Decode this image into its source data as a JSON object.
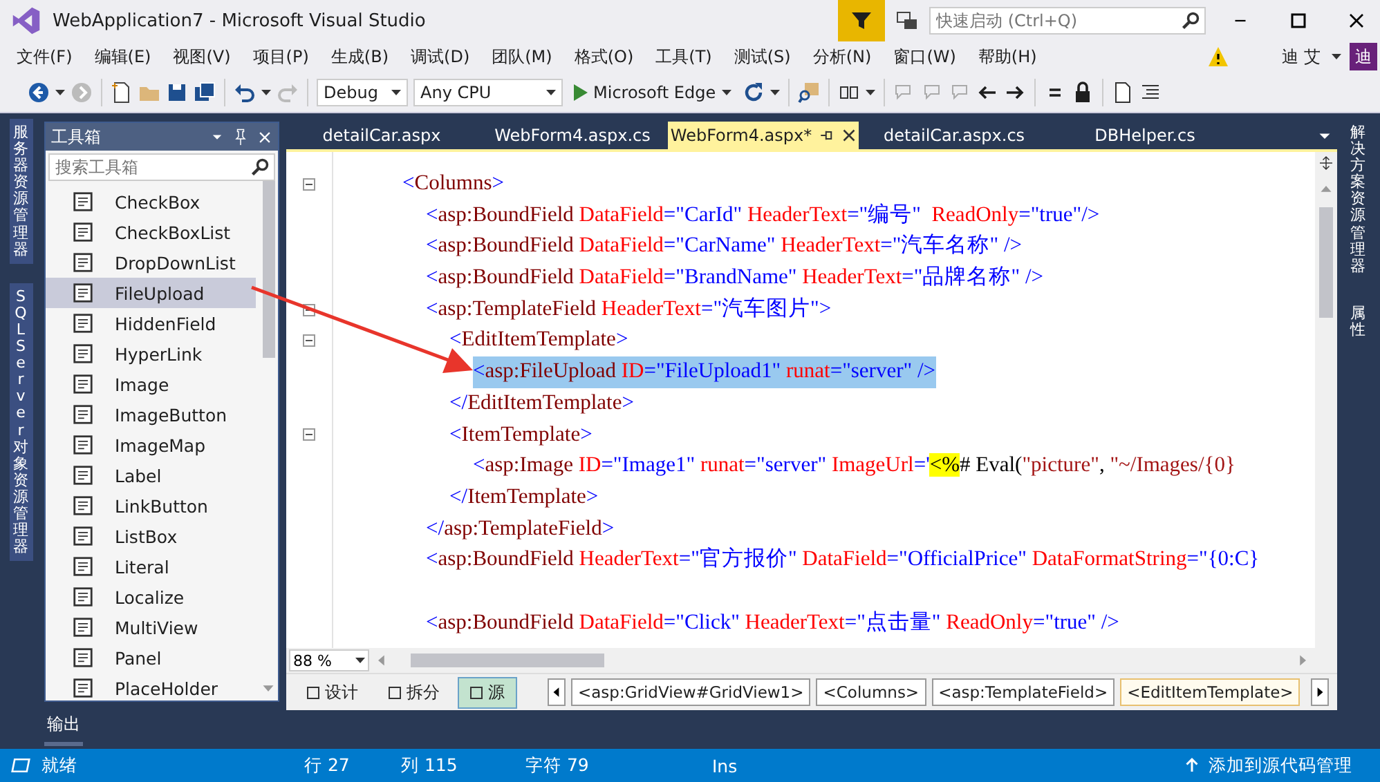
{
  "window": {
    "title": "WebApplication7 - Microsoft Visual Studio"
  },
  "quick_launch": {
    "placeholder": "快速启动 (Ctrl+Q)"
  },
  "menu": [
    "文件(F)",
    "编辑(E)",
    "视图(V)",
    "项目(P)",
    "生成(B)",
    "调试(D)",
    "团队(M)",
    "格式(O)",
    "工具(T)",
    "测试(S)",
    "分析(N)",
    "窗口(W)",
    "帮助(H)"
  ],
  "user": {
    "name": "迪 艾",
    "avatar": "迪"
  },
  "toolbar": {
    "configuration": "Debug",
    "platform": "Any CPU",
    "run_target": "Microsoft Edge"
  },
  "left_side_tabs": [
    "服务器资源管理器",
    "SQL Server 对象资源管理器"
  ],
  "right_side_tabs": [
    "解决方案资源管理器",
    "属性"
  ],
  "toolbox": {
    "title": "工具箱",
    "search": {
      "placeholder": "搜索工具箱"
    },
    "items": [
      {
        "label": "CheckBox",
        "selected": false
      },
      {
        "label": "CheckBoxList",
        "selected": false
      },
      {
        "label": "DropDownList",
        "selected": false
      },
      {
        "label": "FileUpload",
        "selected": true
      },
      {
        "label": "HiddenField",
        "selected": false
      },
      {
        "label": "HyperLink",
        "selected": false
      },
      {
        "label": "Image",
        "selected": false
      },
      {
        "label": "ImageButton",
        "selected": false
      },
      {
        "label": "ImageMap",
        "selected": false
      },
      {
        "label": "Label",
        "selected": false
      },
      {
        "label": "LinkButton",
        "selected": false
      },
      {
        "label": "ListBox",
        "selected": false
      },
      {
        "label": "Literal",
        "selected": false
      },
      {
        "label": "Localize",
        "selected": false
      },
      {
        "label": "MultiView",
        "selected": false
      },
      {
        "label": "Panel",
        "selected": false
      },
      {
        "label": "PlaceHolder",
        "selected": false
      }
    ]
  },
  "editor_tabs": [
    {
      "label": "detailCar.aspx",
      "selected": false
    },
    {
      "label": "WebForm4.aspx.cs",
      "selected": false
    },
    {
      "label": "WebForm4.aspx*",
      "selected": true
    },
    {
      "label": "detailCar.aspx.cs",
      "selected": false
    },
    {
      "label": "DBHelper.cs",
      "selected": false
    }
  ],
  "code_lines": [
    {
      "kind": "code",
      "foldable": true,
      "selected": false,
      "tokens": [
        {
          "kind": "punct",
          "text": "<"
        },
        {
          "kind": "tag",
          "text": "Columns"
        },
        {
          "kind": "punct",
          "text": ">"
        }
      ],
      "children": [
        {
          "kind": "code",
          "selected": false,
          "tokens": [
            {
              "kind": "punct",
              "text": "<"
            },
            {
              "kind": "tag",
              "text": "asp:BoundField"
            },
            {
              "kind": "attr",
              "text": " DataField"
            },
            {
              "kind": "value",
              "text": "=\"CarId\""
            },
            {
              "kind": "attr",
              "text": " HeaderText"
            },
            {
              "kind": "value",
              "text": "=\"编号\""
            },
            {
              "kind": "attr",
              "text": "  ReadOnly"
            },
            {
              "kind": "value",
              "text": "=\"true\"/>"
            }
          ]
        },
        {
          "kind": "code",
          "selected": false,
          "tokens": [
            {
              "kind": "punct",
              "text": "<"
            },
            {
              "kind": "tag",
              "text": "asp:BoundField"
            },
            {
              "kind": "attr",
              "text": " DataField"
            },
            {
              "kind": "value",
              "text": "=\"CarName\""
            },
            {
              "kind": "attr",
              "text": " HeaderText"
            },
            {
              "kind": "value",
              "text": "=\"汽车名称\" />"
            }
          ]
        },
        {
          "kind": "code",
          "selected": false,
          "tokens": [
            {
              "kind": "punct",
              "text": "<"
            },
            {
              "kind": "tag",
              "text": "asp:BoundField"
            },
            {
              "kind": "attr",
              "text": " DataField"
            },
            {
              "kind": "value",
              "text": "=\"BrandName\""
            },
            {
              "kind": "attr",
              "text": " HeaderText"
            },
            {
              "kind": "value",
              "text": "=\"品牌名称\" />"
            }
          ]
        },
        {
          "kind": "code",
          "foldable": true,
          "selected": false,
          "tokens": [
            {
              "kind": "punct",
              "text": "<"
            },
            {
              "kind": "tag",
              "text": "asp:TemplateField"
            },
            {
              "kind": "attr",
              "text": " HeaderText"
            },
            {
              "kind": "value",
              "text": "=\"汽车图片\">"
            }
          ],
          "children": [
            {
              "kind": "code",
              "foldable": true,
              "selected": false,
              "tokens": [
                {
                  "kind": "punct",
                  "text": "<"
                },
                {
                  "kind": "tag",
                  "text": "EditItemTemplate"
                },
                {
                  "kind": "punct",
                  "text": ">"
                }
              ],
              "children": [
                {
                  "kind": "code",
                  "selected": true,
                  "tokens": [
                    {
                      "kind": "punct",
                      "text": "<"
                    },
                    {
                      "kind": "tag",
                      "text": "asp:FileUpload"
                    },
                    {
                      "kind": "attr",
                      "text": " ID"
                    },
                    {
                      "kind": "value",
                      "text": "=\"FileUpload1\""
                    },
                    {
                      "kind": "attr",
                      "text": " runat"
                    },
                    {
                      "kind": "value",
                      "text": "=\"server\" />"
                    }
                  ]
                }
              ]
            },
            {
              "kind": "code",
              "selected": false,
              "tokens": [
                {
                  "kind": "punct",
                  "text": "</"
                },
                {
                  "kind": "tag",
                  "text": "EditItemTemplate"
                },
                {
                  "kind": "punct",
                  "text": ">"
                }
              ]
            },
            {
              "kind": "code",
              "foldable": true,
              "selected": false,
              "tokens": [
                {
                  "kind": "punct",
                  "text": "<"
                },
                {
                  "kind": "tag",
                  "text": "ItemTemplate"
                },
                {
                  "kind": "punct",
                  "text": ">"
                }
              ],
              "children": [
                {
                  "kind": "code",
                  "selected": false,
                  "tokens": [
                    {
                      "kind": "punct",
                      "text": "<"
                    },
                    {
                      "kind": "tag",
                      "text": "asp:Image"
                    },
                    {
                      "kind": "attr",
                      "text": " ID"
                    },
                    {
                      "kind": "value",
                      "text": "=\"Image1\""
                    },
                    {
                      "kind": "attr",
                      "text": " runat"
                    },
                    {
                      "kind": "value",
                      "text": "=\"server\""
                    },
                    {
                      "kind": "attr",
                      "text": " ImageUrl"
                    },
                    {
                      "kind": "value",
                      "text": "='"
                    },
                    {
                      "kind": "server",
                      "text": "<%"
                    },
                    {
                      "kind": "plain",
                      "text": "# Eval("
                    },
                    {
                      "kind": "string",
                      "text": "\"picture\""
                    },
                    {
                      "kind": "plain",
                      "text": ", "
                    },
                    {
                      "kind": "string",
                      "text": "\"~/Images/{0}"
                    }
                  ]
                }
              ]
            },
            {
              "kind": "code",
              "selected": false,
              "tokens": [
                {
                  "kind": "punct",
                  "text": "</"
                },
                {
                  "kind": "tag",
                  "text": "ItemTemplate"
                },
                {
                  "kind": "punct",
                  "text": ">"
                }
              ]
            }
          ]
        },
        {
          "kind": "code",
          "selected": false,
          "tokens": [
            {
              "kind": "punct",
              "text": "</"
            },
            {
              "kind": "tag",
              "text": "asp:TemplateField"
            },
            {
              "kind": "punct",
              "text": ">"
            }
          ]
        },
        {
          "kind": "code",
          "selected": false,
          "tokens": [
            {
              "kind": "punct",
              "text": "<"
            },
            {
              "kind": "tag",
              "text": "asp:BoundField"
            },
            {
              "kind": "attr",
              "text": " HeaderText"
            },
            {
              "kind": "value",
              "text": "=\"官方报价\""
            },
            {
              "kind": "attr",
              "text": " DataField"
            },
            {
              "kind": "value",
              "text": "=\"OfficialPrice\""
            },
            {
              "kind": "attr",
              "text": " DataFormatString"
            },
            {
              "kind": "value",
              "text": "=\"{0:C}"
            }
          ]
        },
        {
          "kind": "blank"
        },
        {
          "kind": "code",
          "selected": false,
          "tokens": [
            {
              "kind": "punct",
              "text": "<"
            },
            {
              "kind": "tag",
              "text": "asp:BoundField"
            },
            {
              "kind": "attr",
              "text": " DataField"
            },
            {
              "kind": "value",
              "text": "=\"Click\""
            },
            {
              "kind": "attr",
              "text": " HeaderText"
            },
            {
              "kind": "value",
              "text": "=\"点击量\""
            },
            {
              "kind": "attr",
              "text": " ReadOnly"
            },
            {
              "kind": "value",
              "text": "=\"true\" />"
            }
          ]
        }
      ]
    }
  ],
  "zoom": "88 %",
  "views": [
    {
      "label": "设计",
      "selected": false
    },
    {
      "label": "拆分",
      "selected": false
    },
    {
      "label": "源",
      "selected": true
    }
  ],
  "breadcrumbs": [
    {
      "label": "<asp:GridView#GridView1>",
      "selected": false
    },
    {
      "label": "<Columns>",
      "selected": false
    },
    {
      "label": "<asp:TemplateField>",
      "selected": false
    },
    {
      "label": "<EditItemTemplate>",
      "selected": true
    }
  ],
  "output_tab": "输出",
  "status_bar": {
    "state": "就绪",
    "line": "行 27",
    "column": "列 115",
    "char": "字符 79",
    "mode": "Ins",
    "source_control": "添加到源代码管理"
  }
}
